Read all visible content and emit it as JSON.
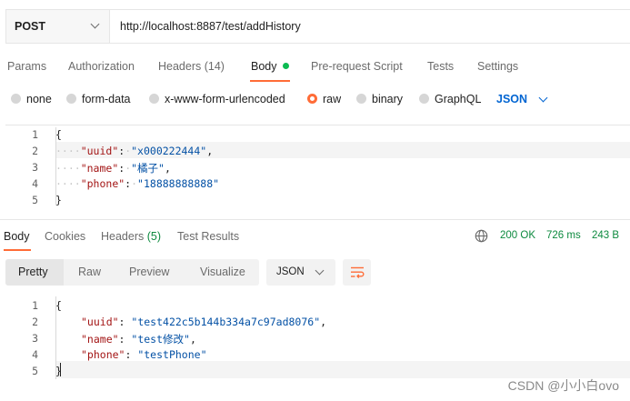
{
  "request": {
    "method": "POST",
    "url": "http://localhost:8887/test/addHistory"
  },
  "request_tabs": [
    {
      "label": "Params"
    },
    {
      "label": "Authorization"
    },
    {
      "label": "Headers",
      "count": "(14)"
    },
    {
      "label": "Body",
      "active": true
    },
    {
      "label": "Pre-request Script"
    },
    {
      "label": "Tests"
    },
    {
      "label": "Settings"
    }
  ],
  "body_types": [
    {
      "label": "none"
    },
    {
      "label": "form-data"
    },
    {
      "label": "x-www-form-urlencoded"
    },
    {
      "label": "raw",
      "selected": true
    },
    {
      "label": "binary"
    },
    {
      "label": "GraphQL"
    }
  ],
  "body_format": "JSON",
  "request_body": {
    "line_numbers": [
      "1",
      "2",
      "3",
      "4",
      "5"
    ],
    "open": "{",
    "close": "}",
    "fields": [
      {
        "key": "\"uuid\"",
        "value": "\"x000222444\"",
        "comma": ","
      },
      {
        "key": "\"name\"",
        "value": "\"橘子\"",
        "comma": ","
      },
      {
        "key": "\"phone\"",
        "value": "\"18888888888\"",
        "comma": ""
      }
    ]
  },
  "response_tabs": [
    {
      "label": "Body",
      "active": true
    },
    {
      "label": "Cookies"
    },
    {
      "label": "Headers",
      "count": "(5)"
    },
    {
      "label": "Test Results"
    }
  ],
  "response_status": {
    "code": "200 OK",
    "time": "726 ms",
    "size": "243 B"
  },
  "view_modes": [
    "Pretty",
    "Raw",
    "Preview",
    "Visualize"
  ],
  "response_format": "JSON",
  "response_body": {
    "line_numbers": [
      "1",
      "2",
      "3",
      "4",
      "5"
    ],
    "open": "{",
    "close": "}",
    "fields": [
      {
        "key": "\"uuid\"",
        "value": "\"test422c5b144b334a7c97ad8076\"",
        "comma": ","
      },
      {
        "key": "\"name\"",
        "value": "\"test修改\"",
        "comma": ","
      },
      {
        "key": "\"phone\"",
        "value": "\"testPhone\"",
        "comma": ""
      }
    ]
  },
  "watermark": "CSDN @小小白ovo",
  "colors": {
    "accent": "#ff6c37",
    "success": "#0cbb52",
    "json_blue": "#0265d2",
    "key": "#a31515",
    "string": "#0451a5"
  }
}
